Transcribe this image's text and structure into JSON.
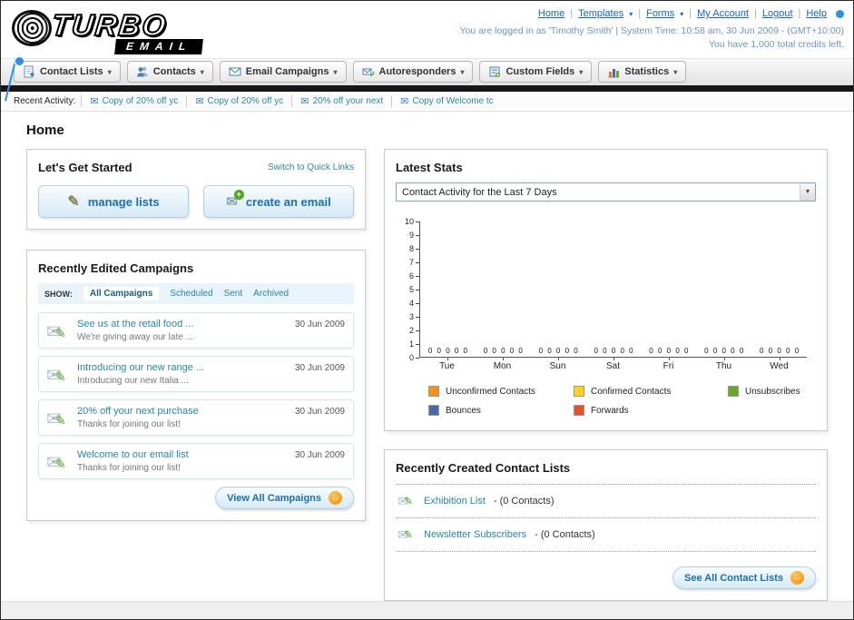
{
  "header": {
    "logo_title": "TURBO",
    "logo_subtitle": "EMAIL",
    "nav_links": [
      "Home",
      "Templates",
      "Forms",
      "My Account",
      "Logout",
      "Help"
    ],
    "login_info": "You are logged in as 'Timothy Smith' | System Time: 10:58 am, 30 Jun 2009 - (GMT+10:00)",
    "credits_info": "You have 1,000 total credits left."
  },
  "nav": {
    "tabs": [
      {
        "label": "Contact Lists",
        "icon": "contact-lists-icon"
      },
      {
        "label": "Contacts",
        "icon": "contacts-icon"
      },
      {
        "label": "Email Campaigns",
        "icon": "email-campaigns-icon"
      },
      {
        "label": "Autoresponders",
        "icon": "autoresponders-icon"
      },
      {
        "label": "Custom Fields",
        "icon": "custom-fields-icon"
      },
      {
        "label": "Statistics",
        "icon": "statistics-icon"
      }
    ]
  },
  "recent_activity": {
    "label": "Recent Activity:",
    "items": [
      "Copy of 20% off yc",
      "Copy of 20% off yc",
      "20% off your next",
      "Copy of Welcome tc"
    ]
  },
  "page_title": "Home",
  "get_started": {
    "title": "Let's Get Started",
    "switch_link": "Switch to Quick Links",
    "buttons": [
      {
        "label": "manage lists",
        "icon": "pencil-icon"
      },
      {
        "label": "create an email",
        "icon": "envelope-plus-icon"
      }
    ]
  },
  "campaigns": {
    "title": "Recently Edited Campaigns",
    "show_label": "SHOW:",
    "filters": [
      "All Campaigns",
      "Scheduled",
      "Sent",
      "Archived"
    ],
    "active_filter": "All Campaigns",
    "items": [
      {
        "title": "See us at the retail food ...",
        "subtitle": "We're giving away our late ...",
        "date": "30 Jun 2009"
      },
      {
        "title": "Introducing our new range ...",
        "subtitle": "Introducing our new Italia ...",
        "date": "30 Jun 2009"
      },
      {
        "title": "20% off your next purchase",
        "subtitle": "Thanks for joining our list!",
        "date": "30 Jun 2009"
      },
      {
        "title": "Welcome to our email list",
        "subtitle": "Thanks for joining our list!",
        "date": "30 Jun 2009"
      }
    ],
    "view_all_label": "View All Campaigns"
  },
  "stats": {
    "title": "Latest Stats",
    "dropdown_value": "Contact Activity for the Last 7 Days",
    "chart_data": {
      "type": "bar",
      "title": "Contact Activity for the Last 7 Days",
      "categories": [
        "Tue",
        "Mon",
        "Sun",
        "Sat",
        "Fri",
        "Thu",
        "Wed"
      ],
      "series": [
        {
          "name": "Unconfirmed Contacts",
          "color": "#f78f1e",
          "values": [
            0,
            0,
            0,
            0,
            0,
            0,
            0
          ]
        },
        {
          "name": "Confirmed Contacts",
          "color": "#ffd21e",
          "values": [
            0,
            0,
            0,
            0,
            0,
            0,
            0
          ]
        },
        {
          "name": "Unsubscribes",
          "color": "#6aa823",
          "values": [
            0,
            0,
            0,
            0,
            0,
            0,
            0
          ]
        },
        {
          "name": "Bounces",
          "color": "#4a69a5",
          "values": [
            0,
            0,
            0,
            0,
            0,
            0,
            0
          ]
        },
        {
          "name": "Forwards",
          "color": "#e8502a",
          "values": [
            0,
            0,
            0,
            0,
            0,
            0,
            0
          ]
        }
      ],
      "ylim": [
        0,
        10
      ],
      "yticks": [
        10,
        9,
        8,
        7,
        6,
        5,
        4,
        3,
        2,
        1,
        0
      ],
      "grid": false,
      "legend_position": "bottom",
      "bar_value_labels": true
    }
  },
  "contact_lists": {
    "title": "Recently Created Contact Lists",
    "items": [
      {
        "name": "Exhibition List",
        "suffix": "- (0 Contacts)"
      },
      {
        "name": "Newsletter Subscribers",
        "suffix": "- (0 Contacts)"
      }
    ],
    "see_all_label": "See All Contact Lists"
  },
  "theme": {
    "link_blue": "#1b64b7",
    "teal_link": "#2b86a8",
    "button_text_blue": "#1b6fae",
    "orange_accent": "#f08c00",
    "black_bar": "#161616"
  }
}
